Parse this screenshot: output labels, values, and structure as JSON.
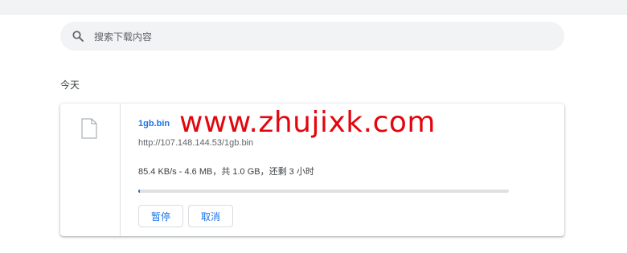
{
  "search": {
    "placeholder": "搜索下载内容",
    "icon": "search-icon"
  },
  "date_group": "今天",
  "download": {
    "file_name": "1gb.bin",
    "url": "http://107.148.144.53/1gb.bin",
    "status": "85.4 KB/s - 4.6 MB，共 1.0 GB，还剩 3 小时",
    "progress_fraction": 0.0046,
    "icon": "file-icon",
    "pause_label": "暂停",
    "cancel_label": "取消"
  },
  "watermark": "www.zhujixk.com",
  "colors": {
    "accent": "#1a73e8",
    "watermark": "#e3060e"
  }
}
